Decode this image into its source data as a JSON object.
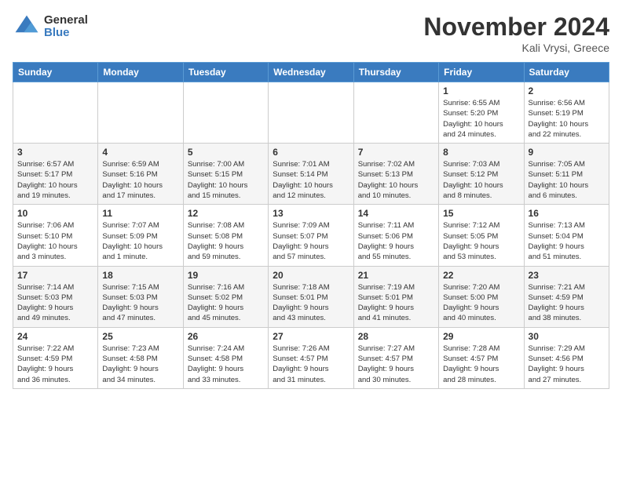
{
  "logo": {
    "general": "General",
    "blue": "Blue"
  },
  "title": "November 2024",
  "location": "Kali Vrysi, Greece",
  "days_of_week": [
    "Sunday",
    "Monday",
    "Tuesday",
    "Wednesday",
    "Thursday",
    "Friday",
    "Saturday"
  ],
  "weeks": [
    [
      {
        "day": "",
        "info": ""
      },
      {
        "day": "",
        "info": ""
      },
      {
        "day": "",
        "info": ""
      },
      {
        "day": "",
        "info": ""
      },
      {
        "day": "",
        "info": ""
      },
      {
        "day": "1",
        "info": "Sunrise: 6:55 AM\nSunset: 5:20 PM\nDaylight: 10 hours\nand 24 minutes."
      },
      {
        "day": "2",
        "info": "Sunrise: 6:56 AM\nSunset: 5:19 PM\nDaylight: 10 hours\nand 22 minutes."
      }
    ],
    [
      {
        "day": "3",
        "info": "Sunrise: 6:57 AM\nSunset: 5:17 PM\nDaylight: 10 hours\nand 19 minutes."
      },
      {
        "day": "4",
        "info": "Sunrise: 6:59 AM\nSunset: 5:16 PM\nDaylight: 10 hours\nand 17 minutes."
      },
      {
        "day": "5",
        "info": "Sunrise: 7:00 AM\nSunset: 5:15 PM\nDaylight: 10 hours\nand 15 minutes."
      },
      {
        "day": "6",
        "info": "Sunrise: 7:01 AM\nSunset: 5:14 PM\nDaylight: 10 hours\nand 12 minutes."
      },
      {
        "day": "7",
        "info": "Sunrise: 7:02 AM\nSunset: 5:13 PM\nDaylight: 10 hours\nand 10 minutes."
      },
      {
        "day": "8",
        "info": "Sunrise: 7:03 AM\nSunset: 5:12 PM\nDaylight: 10 hours\nand 8 minutes."
      },
      {
        "day": "9",
        "info": "Sunrise: 7:05 AM\nSunset: 5:11 PM\nDaylight: 10 hours\nand 6 minutes."
      }
    ],
    [
      {
        "day": "10",
        "info": "Sunrise: 7:06 AM\nSunset: 5:10 PM\nDaylight: 10 hours\nand 3 minutes."
      },
      {
        "day": "11",
        "info": "Sunrise: 7:07 AM\nSunset: 5:09 PM\nDaylight: 10 hours\nand 1 minute."
      },
      {
        "day": "12",
        "info": "Sunrise: 7:08 AM\nSunset: 5:08 PM\nDaylight: 9 hours\nand 59 minutes."
      },
      {
        "day": "13",
        "info": "Sunrise: 7:09 AM\nSunset: 5:07 PM\nDaylight: 9 hours\nand 57 minutes."
      },
      {
        "day": "14",
        "info": "Sunrise: 7:11 AM\nSunset: 5:06 PM\nDaylight: 9 hours\nand 55 minutes."
      },
      {
        "day": "15",
        "info": "Sunrise: 7:12 AM\nSunset: 5:05 PM\nDaylight: 9 hours\nand 53 minutes."
      },
      {
        "day": "16",
        "info": "Sunrise: 7:13 AM\nSunset: 5:04 PM\nDaylight: 9 hours\nand 51 minutes."
      }
    ],
    [
      {
        "day": "17",
        "info": "Sunrise: 7:14 AM\nSunset: 5:03 PM\nDaylight: 9 hours\nand 49 minutes."
      },
      {
        "day": "18",
        "info": "Sunrise: 7:15 AM\nSunset: 5:03 PM\nDaylight: 9 hours\nand 47 minutes."
      },
      {
        "day": "19",
        "info": "Sunrise: 7:16 AM\nSunset: 5:02 PM\nDaylight: 9 hours\nand 45 minutes."
      },
      {
        "day": "20",
        "info": "Sunrise: 7:18 AM\nSunset: 5:01 PM\nDaylight: 9 hours\nand 43 minutes."
      },
      {
        "day": "21",
        "info": "Sunrise: 7:19 AM\nSunset: 5:01 PM\nDaylight: 9 hours\nand 41 minutes."
      },
      {
        "day": "22",
        "info": "Sunrise: 7:20 AM\nSunset: 5:00 PM\nDaylight: 9 hours\nand 40 minutes."
      },
      {
        "day": "23",
        "info": "Sunrise: 7:21 AM\nSunset: 4:59 PM\nDaylight: 9 hours\nand 38 minutes."
      }
    ],
    [
      {
        "day": "24",
        "info": "Sunrise: 7:22 AM\nSunset: 4:59 PM\nDaylight: 9 hours\nand 36 minutes."
      },
      {
        "day": "25",
        "info": "Sunrise: 7:23 AM\nSunset: 4:58 PM\nDaylight: 9 hours\nand 34 minutes."
      },
      {
        "day": "26",
        "info": "Sunrise: 7:24 AM\nSunset: 4:58 PM\nDaylight: 9 hours\nand 33 minutes."
      },
      {
        "day": "27",
        "info": "Sunrise: 7:26 AM\nSunset: 4:57 PM\nDaylight: 9 hours\nand 31 minutes."
      },
      {
        "day": "28",
        "info": "Sunrise: 7:27 AM\nSunset: 4:57 PM\nDaylight: 9 hours\nand 30 minutes."
      },
      {
        "day": "29",
        "info": "Sunrise: 7:28 AM\nSunset: 4:57 PM\nDaylight: 9 hours\nand 28 minutes."
      },
      {
        "day": "30",
        "info": "Sunrise: 7:29 AM\nSunset: 4:56 PM\nDaylight: 9 hours\nand 27 minutes."
      }
    ]
  ]
}
